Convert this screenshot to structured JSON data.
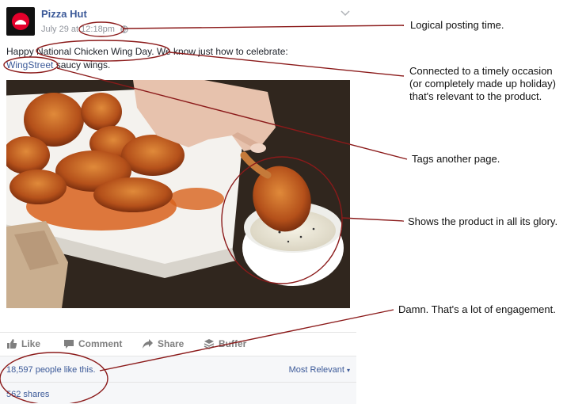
{
  "post": {
    "page_name": "Pizza Hut",
    "date": "July 29 at",
    "time": "12:18pm",
    "text_before": "Happy ",
    "highlight": "National Chicken Wing Day",
    "text_after": ". We know just how to celebrate: ",
    "tag": "WingStreet",
    "text_end": " saucy wings."
  },
  "actions": {
    "like": "Like",
    "comment": "Comment",
    "share": "Share",
    "buffer": "Buffer"
  },
  "stats": {
    "likes": "18,597 people like this.",
    "sort": "Most Relevant",
    "shares": "562 shares"
  },
  "annotations": {
    "time": "Logical posting time.",
    "occasion": [
      "Connected to a timely occasion",
      "(or completely made up holiday)",
      "that's relevant to the product."
    ],
    "tag": "Tags another page.",
    "product": "Shows the product in all its glory.",
    "engagement": "Damn. That's a lot of engagement."
  },
  "colors": {
    "link": "#3b5998",
    "annotation_line": "#8b1a1a",
    "brand_red": "#e4002b"
  }
}
